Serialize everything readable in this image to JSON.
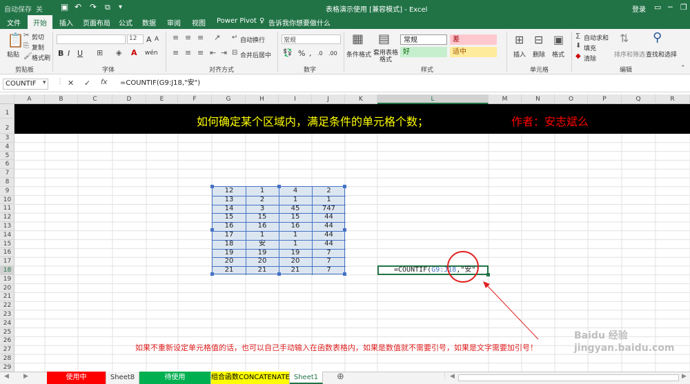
{
  "titlebar": {
    "autosave": "自动保存",
    "autosave_state": "关",
    "doc_title": "表格演示使用  [兼容模式]  -  Excel",
    "login": "登录"
  },
  "tabs": [
    "文件",
    "开始",
    "插入",
    "页面布局",
    "公式",
    "数据",
    "审阅",
    "视图",
    "Power Pivot"
  ],
  "tell_me": "告诉我你想要做什么",
  "ribbon": {
    "clipboard": {
      "paste": "粘贴",
      "cut": "剪切",
      "copy": "复制",
      "format_painter": "格式刷",
      "label": "剪贴板"
    },
    "font": {
      "size": "12",
      "label": "字体",
      "size_up": "A",
      "size_down": "A",
      "bold": "B",
      "italic": "I",
      "underline": "U",
      "phonetic": "wén"
    },
    "alignment": {
      "wrap": "自动换行",
      "merge": "合并后居中",
      "label": "对齐方式"
    },
    "number": {
      "format": "常规",
      "label": "数字",
      "currency": "%",
      "comma": ",",
      "inc_decimal": ".0",
      "dec_decimal": ".00"
    },
    "styles": {
      "cond_format": "条件格式",
      "as_table": "套用表格格式",
      "normal": "常规",
      "bad": "差",
      "good": "好",
      "neutral": "适中",
      "label": "样式"
    },
    "cells": {
      "insert": "插入",
      "delete": "删除",
      "format": "格式",
      "label": "单元格"
    },
    "editing": {
      "autosum": "自动求和",
      "fill": "填充",
      "clear": "清除",
      "sort": "排序和筛选",
      "find": "查找和选择",
      "label": "编辑"
    }
  },
  "formula_bar": {
    "name_box": "COUNTIF",
    "cancel": "✕",
    "enter": "✓",
    "fx": "fx",
    "formula": "=COUNTIF(G9:J18,\"安\")"
  },
  "columns": [
    "A",
    "B",
    "C",
    "D",
    "E",
    "F",
    "G",
    "H",
    "I",
    "J",
    "K",
    "L",
    "M",
    "N",
    "O",
    "P",
    "Q",
    "R"
  ],
  "rows": [
    "1",
    "2",
    "3",
    "4",
    "5",
    "6",
    "7",
    "8",
    "9",
    "10",
    "11",
    "12",
    "13",
    "14",
    "15",
    "16",
    "17",
    "18",
    "19",
    "20",
    "21",
    "22",
    "23",
    "24",
    "25",
    "26",
    "27",
    "28",
    "29"
  ],
  "banner": {
    "title": "如何确定某个区域内，满足条件的单元格个数；",
    "author": "作者：安志斌么"
  },
  "table": [
    [
      "12",
      "1",
      "4",
      "2"
    ],
    [
      "13",
      "2",
      "1",
      "1"
    ],
    [
      "14",
      "3",
      "45",
      "747"
    ],
    [
      "15",
      "15",
      "15",
      "44"
    ],
    [
      "16",
      "16",
      "16",
      "44"
    ],
    [
      "17",
      "1",
      "1",
      "44"
    ],
    [
      "18",
      "安",
      "1",
      "44"
    ],
    [
      "19",
      "19",
      "19",
      "7"
    ],
    [
      "20",
      "20",
      "20",
      "7"
    ],
    [
      "21",
      "21",
      "21",
      "7"
    ]
  ],
  "active_cell": {
    "prefix": "=COUNTIF(",
    "range": "G9:J18",
    "rest": ",\"安\")"
  },
  "note": "如果不重新设定单元格值的话，也可以自己手动输入在函数表格内，如果是数值就不需要引号，如果是文字需要加引号！",
  "watermark": "Baidu 经验  jingyan.baidu.com",
  "sheets": [
    {
      "name": "使用中",
      "bg": "#ff0000",
      "fg": "#ffffff"
    },
    {
      "name": "Sheet8",
      "bg": "#f3f3f3",
      "fg": "#333333"
    },
    {
      "name": "待使用",
      "bg": "#00b050",
      "fg": "#ffffff"
    },
    {
      "name": "组合函数CONCATENATE",
      "bg": "#ffff00",
      "fg": "#000000"
    },
    {
      "name": "Sheet1",
      "bg": "#ffffff",
      "fg": "#217346"
    }
  ],
  "add_sheet": "⊕",
  "colors": {
    "excel_green": "#217346",
    "banner_yellow": "#ffff00",
    "banner_red": "#ff0000",
    "table_fill": "#dce6f1",
    "table_border": "#4472c4"
  }
}
